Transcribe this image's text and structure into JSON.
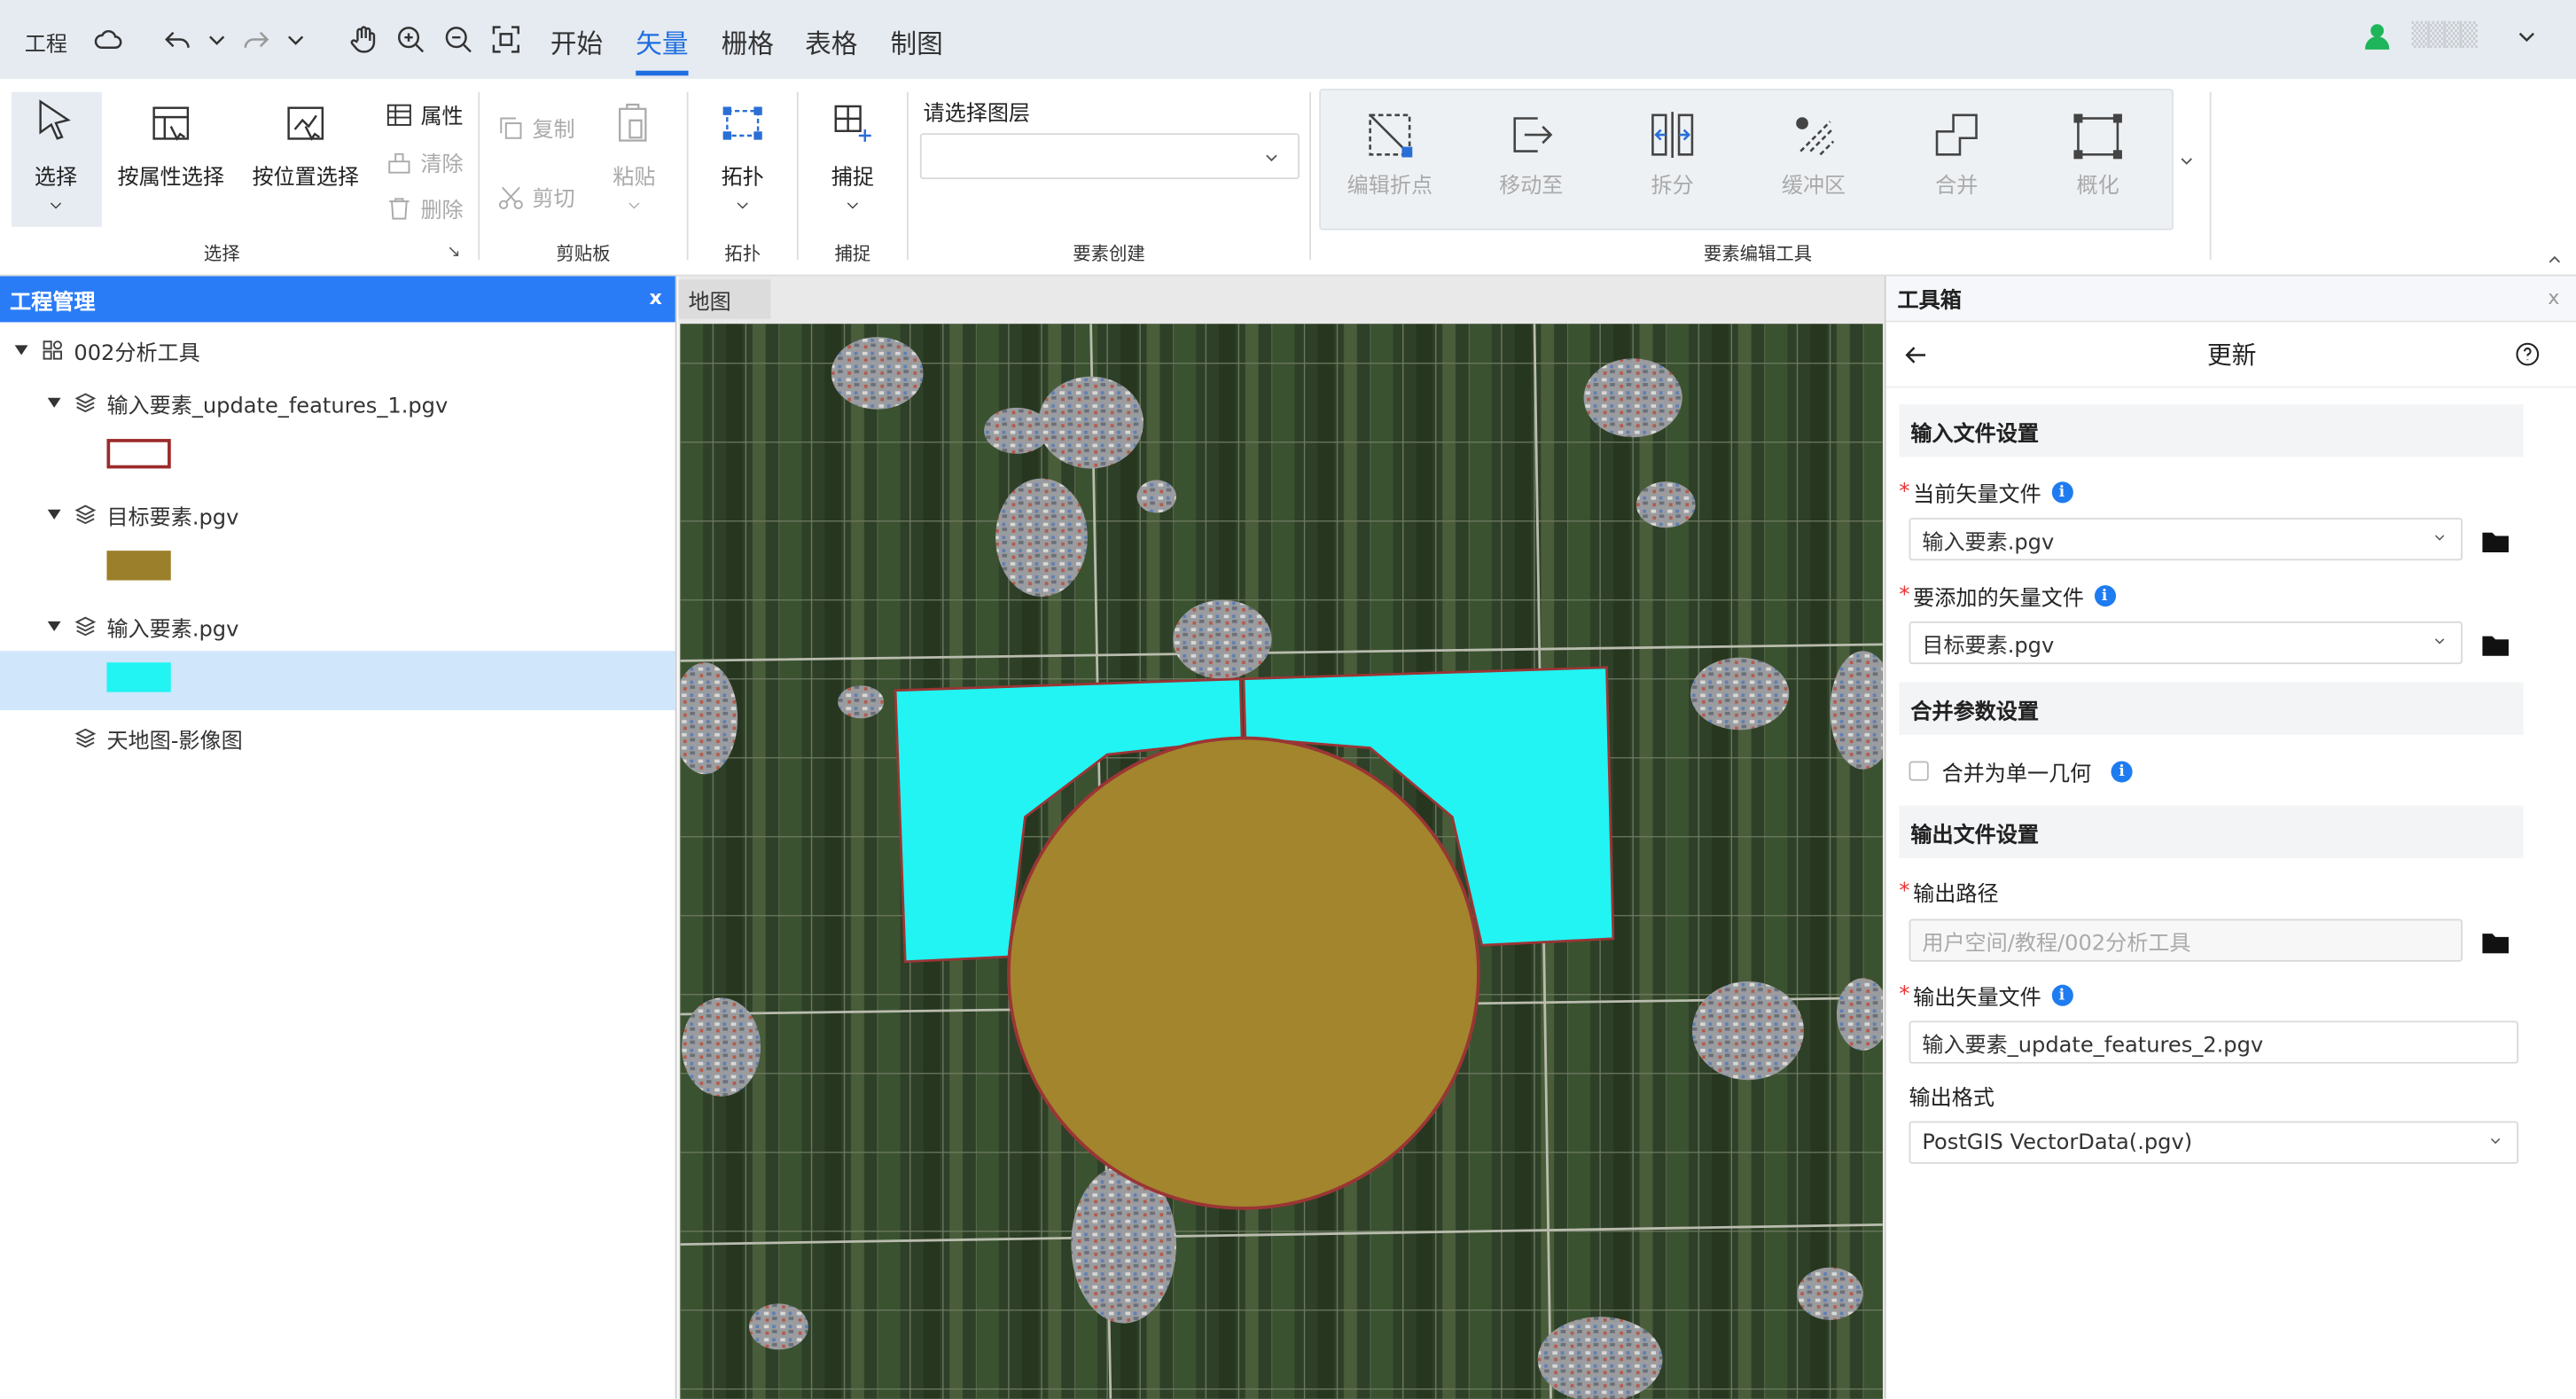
{
  "topbar": {
    "project_label": "工程",
    "menu_tabs": [
      "开始",
      "矢量",
      "栅格",
      "表格",
      "制图"
    ],
    "active_tab": "矢量",
    "user_name": "▒▒▒▒",
    "accent_color": "#1f6fe0"
  },
  "ribbon": {
    "select_group": {
      "select": "选择",
      "attr_select": "按属性选择",
      "loc_select": "按位置选择",
      "props": "属性",
      "clear": "清除",
      "delete": "删除",
      "label": "选择"
    },
    "clipboard_group": {
      "copy": "复制",
      "cut": "剪切",
      "paste": "粘贴",
      "label": "剪贴板"
    },
    "topology_group": {
      "topology": "拓扑",
      "label": "拓扑"
    },
    "snap_group": {
      "snap": "捕捉",
      "label": "捕捉"
    },
    "create_group": {
      "layer_label": "请选择图层",
      "layer_value": "",
      "label": "要素创建"
    },
    "edit_group": {
      "edit_vertex": "编辑折点",
      "move_to": "移动至",
      "split": "拆分",
      "buffer": "缓冲区",
      "merge": "合并",
      "generalize": "概化",
      "label": "要素编辑工具"
    }
  },
  "left_panel": {
    "title": "工程管理",
    "close": "x",
    "root": "002分析工具",
    "layers": [
      {
        "name": "输入要素_update_features_1.pgv",
        "swatch_fill": "#ffffff",
        "swatch_stroke": "#9b2b2b"
      },
      {
        "name": "目标要素.pgv",
        "swatch_fill": "#9c7f2a",
        "swatch_stroke": "#9c7f2a"
      },
      {
        "name": "输入要素.pgv",
        "swatch_fill": "#21f4f2",
        "swatch_stroke": "#21f4f2"
      },
      {
        "name": "天地图-影像图"
      }
    ]
  },
  "map": {
    "tab": "地图",
    "feature_colors": {
      "cyan": "#21f4f2",
      "gold": "#a2852c",
      "outline": "#9b3535"
    }
  },
  "right_panel": {
    "title": "工具箱",
    "close": "x",
    "tool_title": "更新",
    "input_section": "输入文件设置",
    "current_file_label": "当前矢量文件",
    "current_file_value": "输入要素.pgv",
    "add_file_label": "要添加的矢量文件",
    "add_file_value": "目标要素.pgv",
    "merge_section": "合并参数设置",
    "merge_single_label": "合并为单一几何",
    "merge_single_checked": false,
    "output_section": "输出文件设置",
    "output_path_label": "输出路径",
    "output_path_placeholder": "用户空间/教程/002分析工具",
    "output_file_label": "输出矢量文件",
    "output_file_value": "输入要素_update_features_2.pgv",
    "output_format_label": "输出格式",
    "output_format_value": "PostGIS VectorData(.pgv)"
  }
}
